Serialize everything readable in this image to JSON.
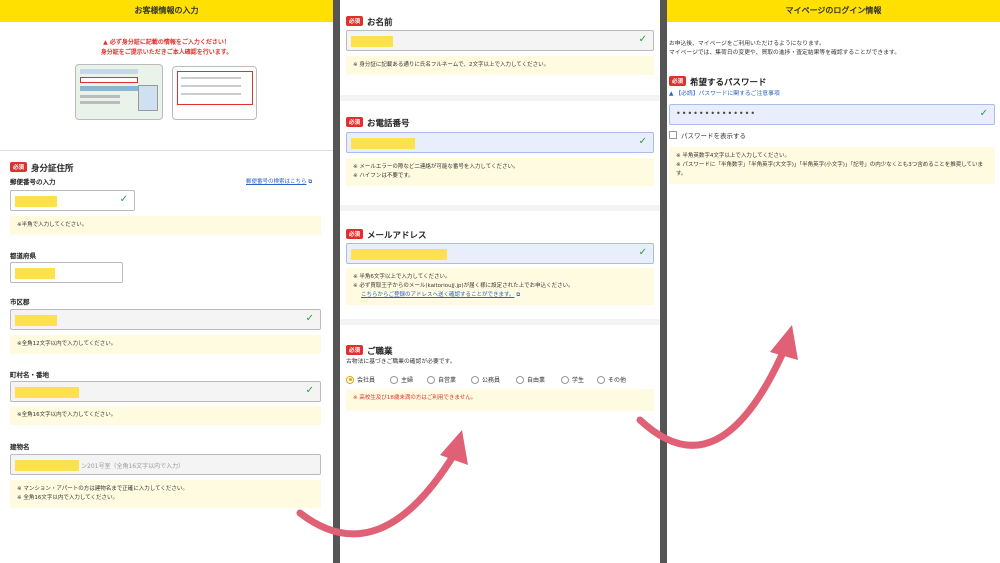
{
  "panel1": {
    "header": "お客様情報の入力",
    "warning_line1": "▲ 必ず身分証に記載の情報をご入力ください！",
    "warning_line2": "身分証をご提示いただきご本人確認を行います。",
    "section_badge": "必須",
    "section_title": "身分証住所",
    "postal_label": "郵便番号の入力",
    "postal_search_link": "郵便番号の検索はこちら",
    "postal_note": "※半角で入力してください。",
    "pref_label": "都道府県",
    "city_label": "市区郡",
    "city_note": "※全角12文字以内で入力してください。",
    "town_label": "町村名・番地",
    "town_note": "※全角16文字以内で入力してください。",
    "building_label": "建物名",
    "building_placeholder": "ン201号室（全角16文字以内で入力）",
    "building_note1": "※ マンション・アパートの方は建物名まで正確に入力してください。",
    "building_note2": "※ 全角16文字以内で入力してください。"
  },
  "panel2": {
    "name_badge": "必須",
    "name_title": "お名前",
    "name_note": "※ 身分証に記載ある通りに氏名フルネームで、2文字以上で入力してください。",
    "phone_badge": "必須",
    "phone_title": "お電話番号",
    "phone_note1": "※ メールエラーの際など二連絡が可能な番号を入力してください。",
    "phone_note2": "※ ハイフンは不要です。",
    "email_badge": "必須",
    "email_title": "メールアドレス",
    "email_note1": "※ 半角6文字以上で入力してください。",
    "email_note2": "※ 必ず買取王子からのメール(kaitorioujj.jp)が届く様に設定された上でお申込ください。",
    "email_note_link": "こちらからご登録のアドレスへ送く確認することができます。",
    "job_badge": "必須",
    "job_title": "ご職業",
    "job_desc": "古物法に基づきご職業の確認が必要です。",
    "job_options": [
      "会社員",
      "主婦",
      "自営業",
      "公務員",
      "自由業",
      "学生",
      "その他"
    ],
    "job_selected": "会社員",
    "job_warning": "※ 高校生及び18歳未満の方はご利用できません。"
  },
  "panel3": {
    "header": "マイページのログイン情報",
    "intro_line1": "お申込後、マイページをご利用いただけるようになります。",
    "intro_line2": "マイページでは、集荷日の変更や、買取の進捗・査定結果等を確認することができます。",
    "password_badge": "必須",
    "password_title": "希望するパスワード",
    "caution_link": "【必読】パスワードに関するご注意事項",
    "password_value": "••••••••••••••",
    "show_password_label": "パスワードを表示する",
    "pw_note1": "※ 半角英数字4文字以上で入力してください。",
    "pw_note2": "※ パスワードに「半角数字」「半角英字(大文字)」「半角英字(小文字)」「記号」の内少なくとも3つ含めることを推奨しています。"
  },
  "colors": {
    "header_yellow": "#ffe000",
    "required_red": "#e0302d",
    "arrow_pink": "#e06075",
    "check_green": "#2a9d3a"
  },
  "icons": [
    "check-icon",
    "warning-icon",
    "external-link-icon",
    "info-icon",
    "curved-arrow-icon"
  ]
}
